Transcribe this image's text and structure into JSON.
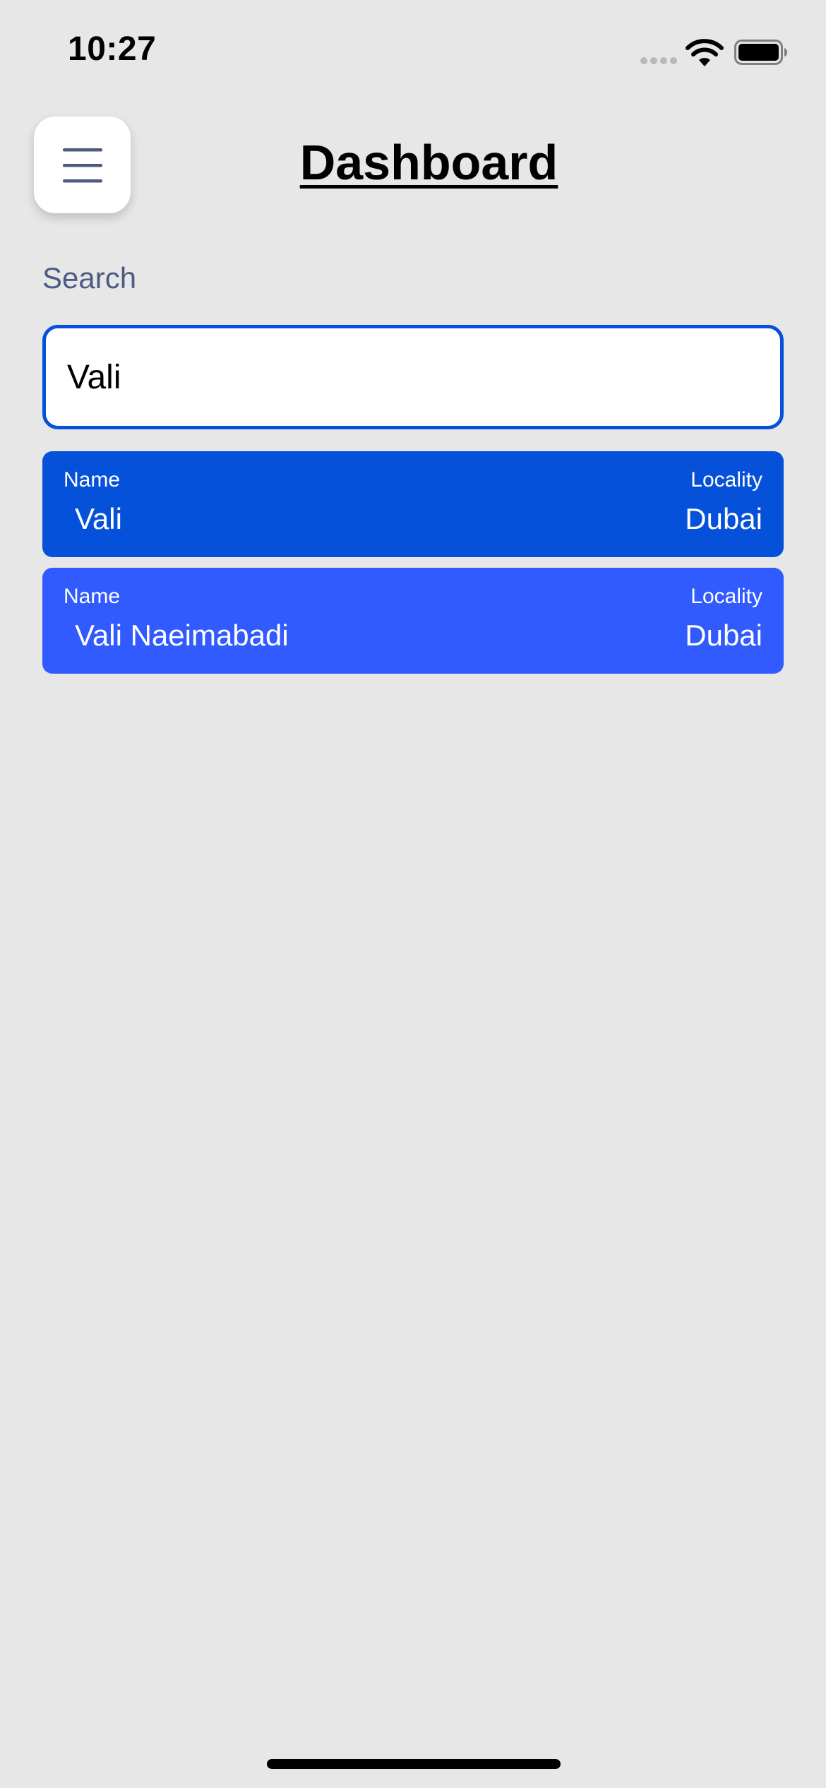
{
  "status_bar": {
    "time": "10:27",
    "icons": [
      "cellular-signal-icon",
      "wifi-icon",
      "battery-icon"
    ]
  },
  "header": {
    "menu_icon": "hamburger-menu-icon",
    "title": "Dashboard"
  },
  "search": {
    "label": "Search",
    "value": "Vali",
    "placeholder": ""
  },
  "results": [
    {
      "name_label": "Name",
      "name": "Vali",
      "locality_label": "Locality",
      "locality": "Dubai"
    },
    {
      "name_label": "Name",
      "name": "Vali Naeimabadi",
      "locality_label": "Locality",
      "locality": "Dubai"
    }
  ],
  "colors": {
    "background": "#e7e7e8",
    "accent": "#0651da",
    "card_primary": "#0651da",
    "card_secondary": "#315bff",
    "label_muted": "#4b5b82"
  }
}
